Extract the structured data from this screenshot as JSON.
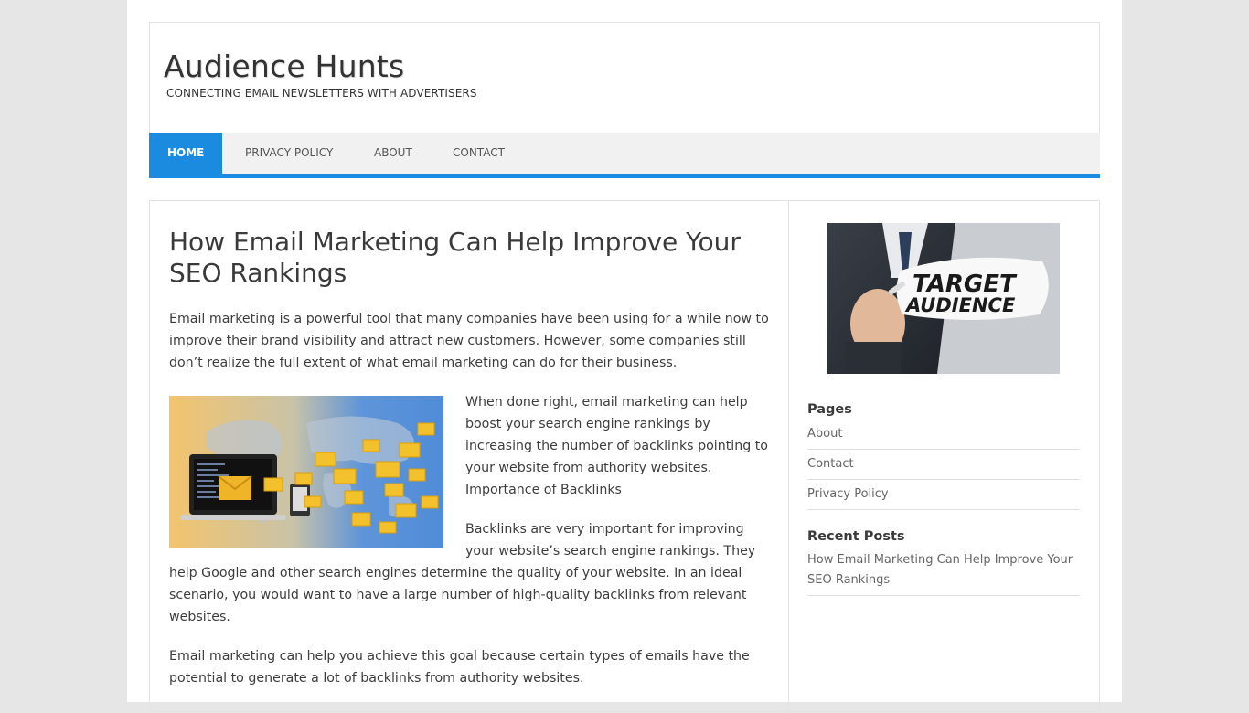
{
  "site": {
    "title": "Audience Hunts",
    "tagline": "CONNECTING EMAIL NEWSLETTERS WITH ADVERTISERS"
  },
  "nav": {
    "items": [
      {
        "label": "HOME",
        "active": true
      },
      {
        "label": "PRIVACY POLICY",
        "active": false
      },
      {
        "label": "ABOUT",
        "active": false
      },
      {
        "label": "CONTACT",
        "active": false
      }
    ]
  },
  "post": {
    "title": "How Email Marketing Can Help Improve Your SEO Rankings",
    "paragraphs": [
      "Email marketing is a powerful tool that many companies have been using for a while now to improve their brand visibility and attract new customers. However, some companies still don’t realize the full extent of what email marketing can do for their business.",
      "When done right, email marketing can help boost your search engine rankings by increasing the number of backlinks pointing to your website from authority websites. Importance of Backlinks",
      "Backlinks are very important for improving your website’s search engine rankings. They help Google and other search engines determine the quality of your website. In an ideal scenario, you would want to have a large number of high-quality backlinks from relevant websites.",
      "Email marketing can help you achieve this goal because certain types of emails have the potential to generate a lot of backlinks from authority websites."
    ],
    "image_icon": "email-marketing-illustration"
  },
  "sidebar": {
    "image_text": [
      "TARGET",
      "AUDIENCE"
    ],
    "pages_title": "Pages",
    "pages": [
      "About",
      "Contact",
      "Privacy Policy"
    ],
    "recent_title": "Recent Posts",
    "recent": [
      "How Email Marketing Can Help Improve Your SEO Rankings"
    ]
  },
  "colors": {
    "accent": "#1b8be0",
    "background": "#e6e6e6"
  }
}
